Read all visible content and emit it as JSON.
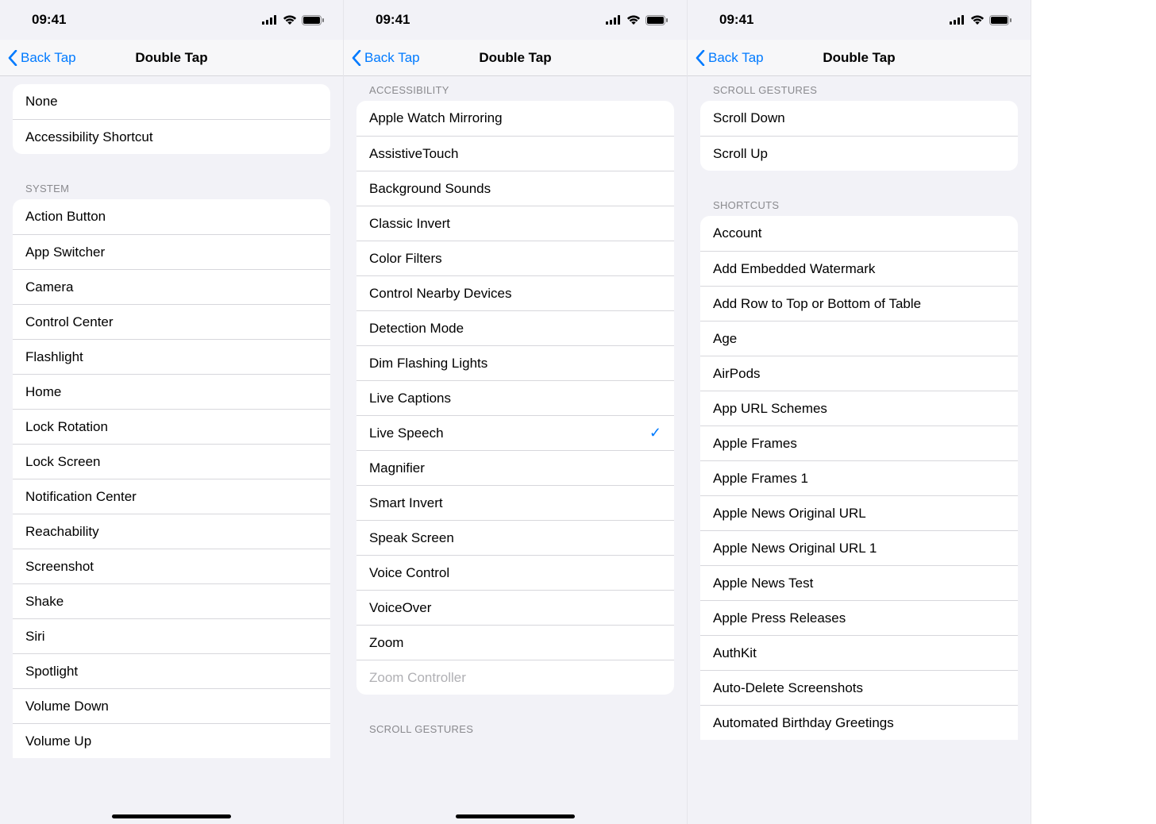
{
  "statusbar": {
    "time": "09:41"
  },
  "nav": {
    "back_label": "Back Tap",
    "title": "Double Tap"
  },
  "screen1": {
    "top_items": [
      "None",
      "Accessibility Shortcut"
    ],
    "system_header": "SYSTEM",
    "system_items": [
      "Action Button",
      "App Switcher",
      "Camera",
      "Control Center",
      "Flashlight",
      "Home",
      "Lock Rotation",
      "Lock Screen",
      "Notification Center",
      "Reachability",
      "Screenshot",
      "Shake",
      "Siri",
      "Spotlight",
      "Volume Down",
      "Volume Up"
    ]
  },
  "screen2": {
    "accessibility_header": "ACCESSIBILITY",
    "accessibility_items": [
      {
        "label": "Apple Watch Mirroring"
      },
      {
        "label": "AssistiveTouch"
      },
      {
        "label": "Background Sounds"
      },
      {
        "label": "Classic Invert"
      },
      {
        "label": "Color Filters"
      },
      {
        "label": "Control Nearby Devices"
      },
      {
        "label": "Detection Mode"
      },
      {
        "label": "Dim Flashing Lights"
      },
      {
        "label": "Live Captions"
      },
      {
        "label": "Live Speech",
        "checked": true
      },
      {
        "label": "Magnifier"
      },
      {
        "label": "Smart Invert"
      },
      {
        "label": "Speak Screen"
      },
      {
        "label": "Voice Control"
      },
      {
        "label": "VoiceOver"
      },
      {
        "label": "Zoom"
      },
      {
        "label": "Zoom Controller",
        "disabled": true
      }
    ],
    "scroll_header": "SCROLL GESTURES"
  },
  "screen3": {
    "scroll_header": "SCROLL GESTURES",
    "scroll_items": [
      "Scroll Down",
      "Scroll Up"
    ],
    "shortcuts_header": "SHORTCUTS",
    "shortcuts_items": [
      "Account",
      "Add Embedded Watermark",
      "Add Row to Top or Bottom of Table",
      "Age",
      "AirPods",
      "App URL Schemes",
      "Apple Frames",
      "Apple Frames 1",
      "Apple News Original URL",
      "Apple News Original URL 1",
      "Apple News Test",
      "Apple Press Releases",
      "AuthKit",
      "Auto-Delete Screenshots",
      "Automated Birthday Greetings"
    ]
  }
}
